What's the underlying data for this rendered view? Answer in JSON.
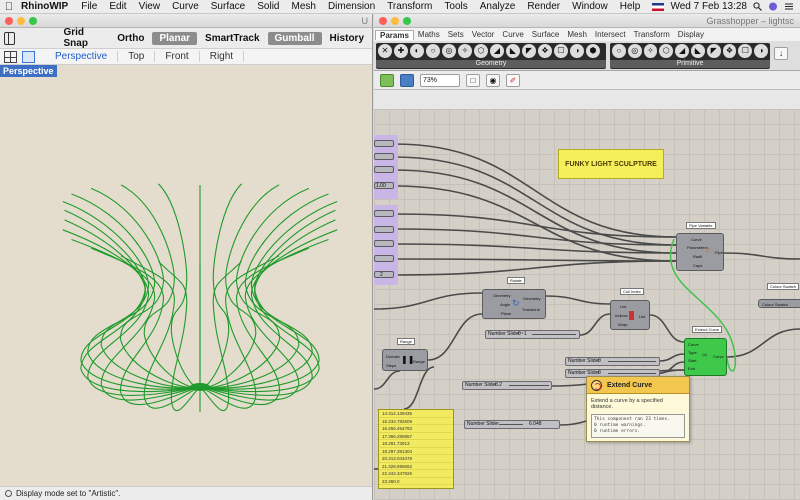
{
  "menubar": {
    "app": "RhinoWIP",
    "items": [
      "File",
      "Edit",
      "View",
      "Curve",
      "Surface",
      "Solid",
      "Mesh",
      "Dimension",
      "Transform",
      "Tools",
      "Analyze",
      "Render",
      "Window",
      "Help"
    ],
    "clock": "Wed 7 Feb  13:28"
  },
  "rhino": {
    "title": "U",
    "toolbar": [
      "Grid Snap",
      "Ortho",
      "Planar",
      "SmartTrack",
      "Gumball",
      "History"
    ],
    "toolbar_active": [
      "Planar",
      "Gumball"
    ],
    "viewport_tabs": [
      "Perspective",
      "Top",
      "Front",
      "Right"
    ],
    "viewport_label": "Perspective",
    "status": "Display mode set to \"Artistic\".",
    "curve_color": "#1f9a2a"
  },
  "grasshopper": {
    "title": "Grasshopper – lightsc",
    "tabs": [
      "Params",
      "Maths",
      "Sets",
      "Vector",
      "Curve",
      "Surface",
      "Mesh",
      "Intersect",
      "Transform",
      "Display"
    ],
    "ribbon_groups": [
      {
        "label": "Geometry",
        "icons": 14
      },
      {
        "label": "Primitive",
        "icons": 10
      }
    ],
    "zoom": "73%",
    "title_panel": "FUNKY LIGHT SCULPTURE",
    "components": {
      "pipe": {
        "tag": "Pipe Variable",
        "inputs": [
          "Curve",
          "Parameters",
          "Radii",
          "Caps"
        ],
        "output": "Pipe"
      },
      "rotate": {
        "tag": "Rotate",
        "inputs": [
          "Geometry",
          "Angle",
          "Plane"
        ],
        "outputs": [
          "Geometry",
          "Transform"
        ]
      },
      "cull": {
        "tag": "Cull Index",
        "inputs": [
          "List",
          "Indices",
          "Wrap"
        ],
        "output": "List"
      },
      "range": {
        "tag": "Range",
        "inputs": [
          "Domain",
          "Steps"
        ],
        "output": "Range"
      },
      "extend": {
        "tag": "Extend Curve",
        "inputs": [
          "Curve",
          "Type",
          "Start",
          "End"
        ],
        "output": "Curve"
      },
      "colour": {
        "tag": "Colour Swatch",
        "label": "Colour Swatch"
      }
    },
    "sliders": [
      {
        "label": "Number Slider",
        "value": "0~1"
      },
      {
        "label": "Number Slider",
        "value": "0"
      },
      {
        "label": "Number Slider",
        "value": "0"
      },
      {
        "label": "Number Slider",
        "value": "0.2"
      },
      {
        "label": "Number Slider",
        "value": "6.048"
      }
    ],
    "left_params": [
      "1.00",
      "2"
    ],
    "list_values": [
      "14.314.139435",
      "15.234.782609",
      "16.256.454783",
      "17.366.286957",
      "18.281.73913",
      "19.297.391304",
      "20.313.043478",
      "21.328.695652",
      "22.344.347826",
      "23.360.0"
    ],
    "tooltip": {
      "title": "Extend Curve",
      "description": "Extend a curve by a specified distance.",
      "log": [
        "This component ran 23 times.",
        "0 runtime warnings.",
        "0 runtime errors."
      ]
    }
  }
}
